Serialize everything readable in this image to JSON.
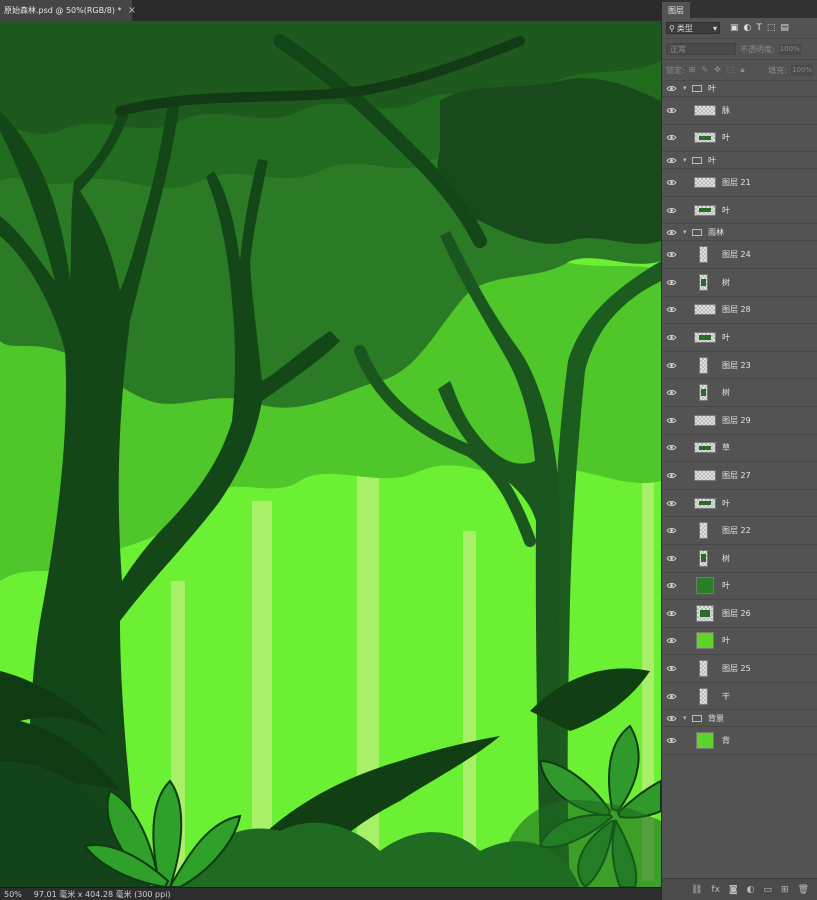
{
  "document_tab": {
    "title": "原始森林.psd @ 50%(RGB/8) *",
    "close_icon": "close-icon"
  },
  "status_bar": {
    "zoom": "50%",
    "doc_size": "97.01 毫米 x 404.28 毫米 (300 ppi)"
  },
  "layers_panel": {
    "tab_label": "图层",
    "filter_label": "类型",
    "blend_mode": "正常",
    "opacity_label": "不透明度:",
    "opacity_value": "100%",
    "lock_label": "锁定:",
    "fill_label": "填充:",
    "fill_value": "100%",
    "layers": [
      {
        "name": "叶",
        "kind": "group"
      },
      {
        "name": "脉",
        "kind": "layer",
        "thumb": "wide"
      },
      {
        "name": "叶",
        "kind": "layer",
        "thumb": "wide-mark"
      },
      {
        "name": "叶",
        "kind": "group"
      },
      {
        "name": "图层 21",
        "kind": "layer",
        "thumb": "wide"
      },
      {
        "name": "叶",
        "kind": "layer",
        "thumb": "wide-mark"
      },
      {
        "name": "雨林",
        "kind": "group"
      },
      {
        "name": "图层 24",
        "kind": "layer",
        "thumb": "narrow"
      },
      {
        "name": "树",
        "kind": "layer",
        "thumb": "narrow-mark"
      },
      {
        "name": "图层 28",
        "kind": "layer",
        "thumb": "wide"
      },
      {
        "name": "叶",
        "kind": "layer",
        "thumb": "wide-mark"
      },
      {
        "name": "图层 23",
        "kind": "layer",
        "thumb": "narrow"
      },
      {
        "name": "树",
        "kind": "layer",
        "thumb": "narrow-mark"
      },
      {
        "name": "图层 29",
        "kind": "layer",
        "thumb": "wide"
      },
      {
        "name": "草",
        "kind": "layer",
        "thumb": "wide-mark"
      },
      {
        "name": "图层 27",
        "kind": "layer",
        "thumb": "wide"
      },
      {
        "name": "叶",
        "kind": "layer",
        "thumb": "wide-mark"
      },
      {
        "name": "图层 22",
        "kind": "layer",
        "thumb": "narrow"
      },
      {
        "name": "树",
        "kind": "layer",
        "thumb": "narrow-mark"
      },
      {
        "name": "叶",
        "kind": "layer",
        "thumb": "green-dark"
      },
      {
        "name": "图层 26",
        "kind": "layer",
        "thumb": "square"
      },
      {
        "name": "叶",
        "kind": "layer",
        "thumb": "green-bright"
      },
      {
        "name": "图层 25",
        "kind": "layer",
        "thumb": "narrow"
      },
      {
        "name": "干",
        "kind": "layer",
        "thumb": "narrow"
      },
      {
        "name": "背景",
        "kind": "group"
      },
      {
        "name": "背",
        "kind": "layer",
        "thumb": "green-bright"
      }
    ],
    "bottom_icons": [
      "link-icon",
      "fx-icon",
      "mask-icon",
      "adjustment-icon",
      "new-group-icon",
      "new-layer-icon",
      "trash-icon"
    ]
  }
}
